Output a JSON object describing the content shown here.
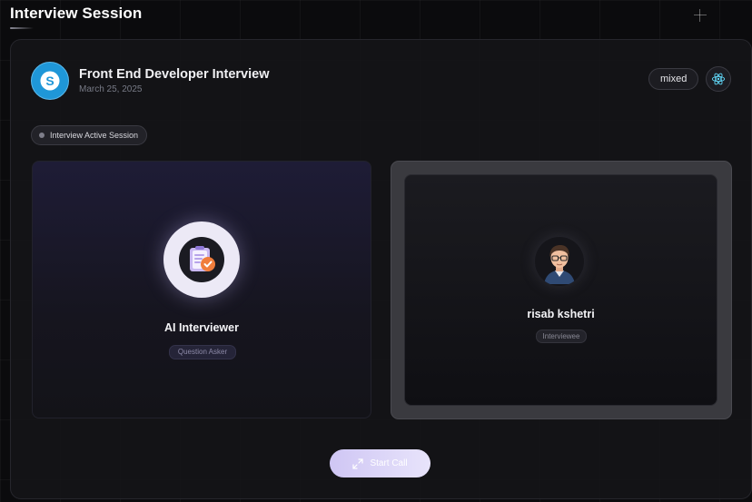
{
  "page": {
    "title": "Interview Session"
  },
  "session": {
    "title": "Front End Developer Interview",
    "date": "March 25, 2025",
    "badge": "mixed",
    "tech_icon": "react-icon",
    "logo_icon": "skype-logo-icon",
    "status": "Interview Active Session"
  },
  "ai_card": {
    "name": "AI Interviewer",
    "role": "Question Asker",
    "avatar_icon": "ai-interviewer-icon"
  },
  "user_card": {
    "name": "risab kshetri",
    "role": "Interviewee",
    "avatar_icon": "user-avatar"
  },
  "actions": {
    "start_call_label": "Start Call",
    "start_call_icon": "expand-icon"
  },
  "colors": {
    "background": "#0b0b0d",
    "accent": "#cfc6f4",
    "logo": "#1f97d8",
    "react": "#61dafb"
  }
}
